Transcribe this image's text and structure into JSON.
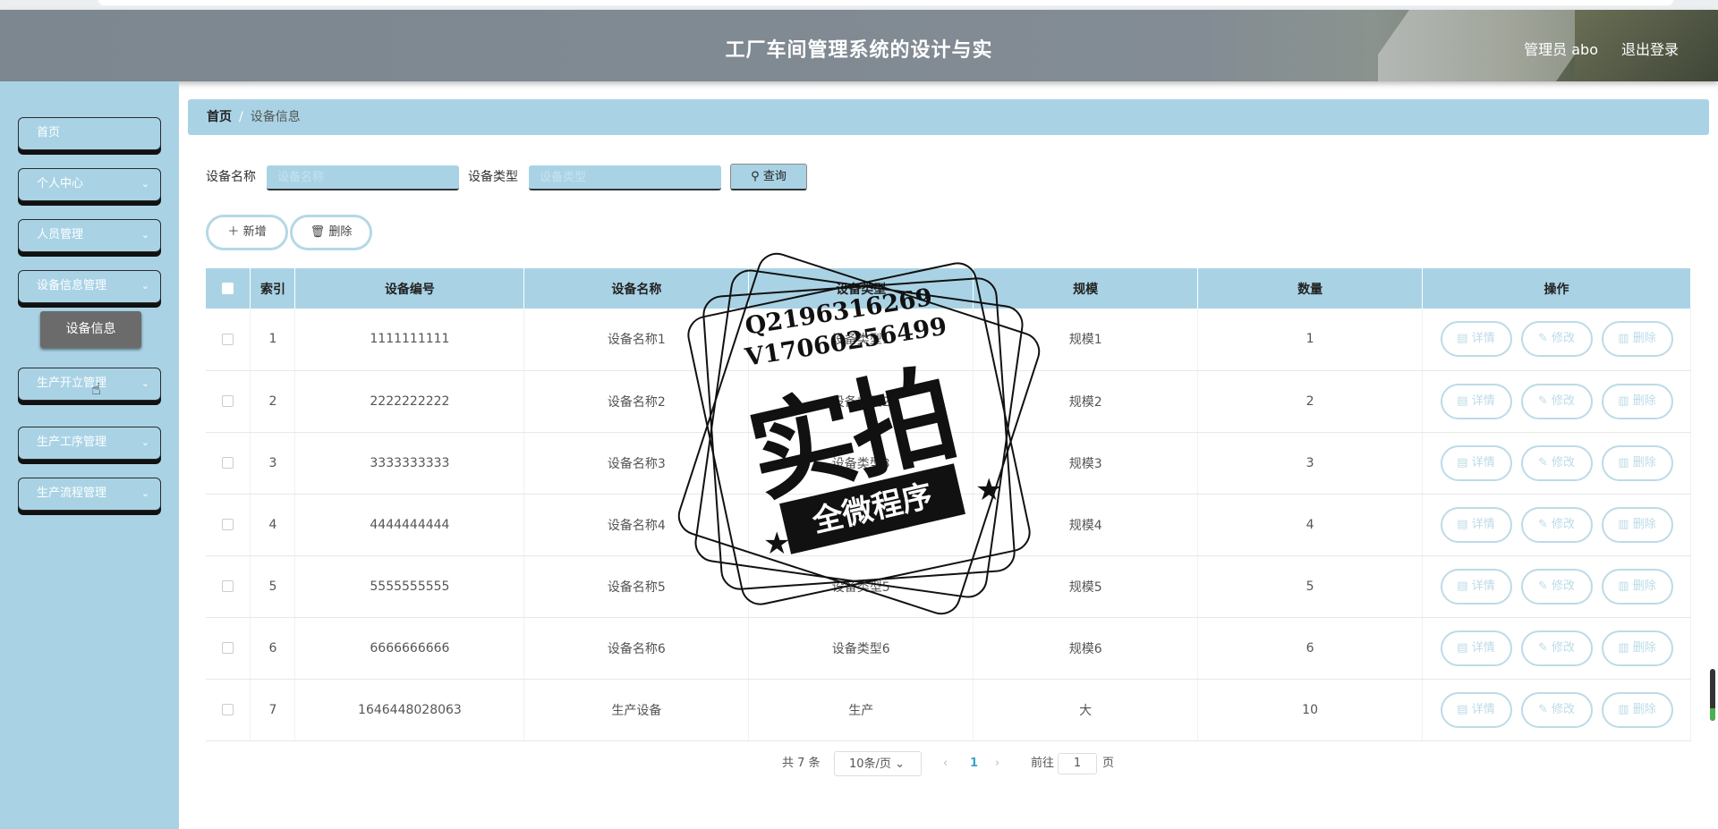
{
  "header": {
    "title": "工厂车间管理系统的设计与实",
    "user": "管理员 abo",
    "logout": "退出登录"
  },
  "sidebar": {
    "items": [
      {
        "label": "首页"
      },
      {
        "label": "个人中心",
        "chevron": "⌄"
      },
      {
        "label": "人员管理",
        "chevron": "⌄"
      },
      {
        "label": "设备信息管理",
        "chevron": "⌄"
      },
      {
        "label": "生产开立管理",
        "chevron": "⌄"
      },
      {
        "label": "生产工序管理",
        "chevron": "⌄"
      },
      {
        "label": "生产流程管理",
        "chevron": "⌄"
      }
    ],
    "submenu": {
      "label": "设备信息"
    }
  },
  "breadcrumb": {
    "home": "首页",
    "separator": "/",
    "current": "设备信息"
  },
  "search": {
    "name_label": "设备名称",
    "name_placeholder": "设备名称",
    "type_label": "设备类型",
    "type_placeholder": "设备类型",
    "query_button": "查询"
  },
  "actions": {
    "add": "新增",
    "delete": "删除"
  },
  "table": {
    "headers": [
      "索引",
      "设备编号",
      "设备名称",
      "设备类型",
      "规模",
      "数量",
      "操作"
    ],
    "rows": [
      [
        "1",
        "1111111111",
        "设备名称1",
        "设备类型1",
        "规模1",
        "1"
      ],
      [
        "2",
        "2222222222",
        "设备名称2",
        "设备类型2",
        "规模2",
        "2"
      ],
      [
        "3",
        "3333333333",
        "设备名称3",
        "设备类型3",
        "规模3",
        "3"
      ],
      [
        "4",
        "4444444444",
        "设备名称4",
        "设备类型4",
        "规模4",
        "4"
      ],
      [
        "5",
        "5555555555",
        "设备名称5",
        "设备类型5",
        "规模5",
        "5"
      ],
      [
        "6",
        "6666666666",
        "设备名称6",
        "设备类型6",
        "规模6",
        "6"
      ],
      [
        "7",
        "1646448028063",
        "生产设备",
        "生产",
        "大",
        "10"
      ]
    ],
    "op_buttons": {
      "detail": "详情",
      "edit": "修改",
      "delete": "删除"
    }
  },
  "pagination": {
    "total": "共 7 条",
    "page_size": "10条/页",
    "current_page": "1",
    "goto_prefix": "前往",
    "goto_value": "1",
    "goto_suffix": "页"
  },
  "watermark": {
    "line1": "Q2196316269",
    "line2": "V17060256499",
    "big": "实拍",
    "ribbon": "全微程序"
  },
  "colors": {
    "accent": "#a9d3e5",
    "header": "#838c94",
    "submenu": "#6b6b6b",
    "page_active": "#3fa2c9"
  }
}
